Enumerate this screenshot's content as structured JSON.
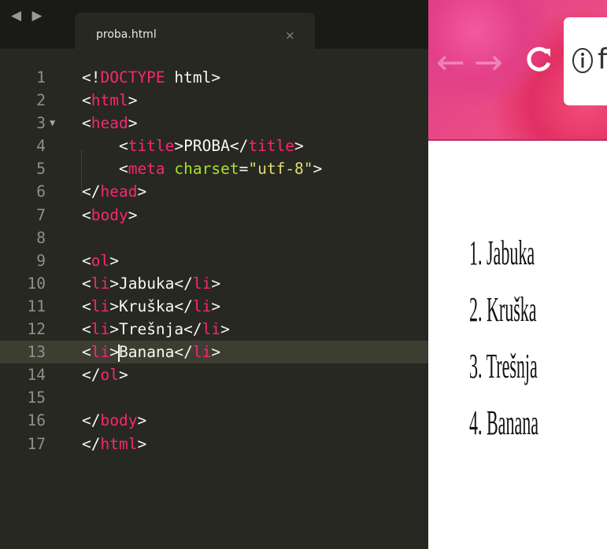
{
  "editor": {
    "tab_nav_arrows": "◀ ▶",
    "tab_title": "proba.html",
    "tab_close": "×",
    "current_line": 13,
    "lines": [
      {
        "n": "1",
        "tokens": [
          [
            "d",
            "<!"
          ],
          [
            "pk",
            "DOCTYPE"
          ],
          [
            "d",
            " html>"
          ]
        ]
      },
      {
        "n": "2",
        "tokens": [
          [
            "d",
            "<"
          ],
          [
            "pk",
            "html"
          ],
          [
            "d",
            ">"
          ]
        ]
      },
      {
        "n": "3",
        "fold": "▼",
        "tokens": [
          [
            "d",
            "<"
          ],
          [
            "pk",
            "head"
          ],
          [
            "d",
            ">"
          ]
        ]
      },
      {
        "n": "4",
        "tokens": [
          [
            "d",
            "    <"
          ],
          [
            "pk",
            "title"
          ],
          [
            "d",
            ">PROBA</"
          ],
          [
            "pk",
            "title"
          ],
          [
            "d",
            ">"
          ]
        ]
      },
      {
        "n": "5",
        "tokens": [
          [
            "d",
            "    <"
          ],
          [
            "pk",
            "meta"
          ],
          [
            "d",
            " "
          ],
          [
            "gr",
            "charset"
          ],
          [
            "d",
            "="
          ],
          [
            "yl",
            "\"utf-8\""
          ],
          [
            "d",
            ">"
          ]
        ]
      },
      {
        "n": "6",
        "tokens": [
          [
            "d",
            "</"
          ],
          [
            "pk",
            "head"
          ],
          [
            "d",
            ">"
          ]
        ]
      },
      {
        "n": "7",
        "tokens": [
          [
            "d",
            "<"
          ],
          [
            "pk",
            "body"
          ],
          [
            "d",
            ">"
          ]
        ]
      },
      {
        "n": "8",
        "tokens": []
      },
      {
        "n": "9",
        "tokens": [
          [
            "d",
            "<"
          ],
          [
            "pk",
            "ol"
          ],
          [
            "d",
            ">"
          ]
        ]
      },
      {
        "n": "10",
        "tokens": [
          [
            "d",
            "<"
          ],
          [
            "pk",
            "li"
          ],
          [
            "d",
            ">Jabuka</"
          ],
          [
            "pk",
            "li"
          ],
          [
            "d",
            ">"
          ]
        ]
      },
      {
        "n": "11",
        "tokens": [
          [
            "d",
            "<"
          ],
          [
            "pk",
            "li"
          ],
          [
            "d",
            ">Kruška</"
          ],
          [
            "pk",
            "li"
          ],
          [
            "d",
            ">"
          ]
        ]
      },
      {
        "n": "12",
        "tokens": [
          [
            "d",
            "<"
          ],
          [
            "pk",
            "li"
          ],
          [
            "d",
            ">Trešnja</"
          ],
          [
            "pk",
            "li"
          ],
          [
            "d",
            ">"
          ]
        ]
      },
      {
        "n": "13",
        "tokens": [
          [
            "d",
            "<"
          ],
          [
            "pk",
            "li"
          ],
          [
            "d",
            ">"
          ],
          [
            "cursor",
            ""
          ],
          [
            "d",
            "Banana</"
          ],
          [
            "pk",
            "li"
          ],
          [
            "d",
            ">"
          ]
        ]
      },
      {
        "n": "14",
        "tokens": [
          [
            "d",
            "</"
          ],
          [
            "pk",
            "ol"
          ],
          [
            "d",
            ">"
          ]
        ]
      },
      {
        "n": "15",
        "tokens": []
      },
      {
        "n": "16",
        "tokens": [
          [
            "d",
            "</"
          ],
          [
            "pk",
            "body"
          ],
          [
            "d",
            ">"
          ]
        ]
      },
      {
        "n": "17",
        "tokens": [
          [
            "d",
            "</"
          ],
          [
            "pk",
            "html"
          ],
          [
            "d",
            ">"
          ]
        ]
      }
    ]
  },
  "browser": {
    "back_icon": "arrow-left-icon",
    "forward_icon": "arrow-right-icon",
    "reload_icon": "reload-icon",
    "info_icon": "info-icon",
    "address_text": "f",
    "list_items": [
      "1. Jabuka",
      "2. Kruška",
      "3. Trešnja",
      "4. Banana"
    ]
  },
  "colors": {
    "editor_bg": "#272822",
    "tag": "#f92672",
    "attribute": "#a6e22e",
    "string": "#e6db74",
    "text": "#f8f8f2",
    "line_number": "#8f908a",
    "toolbar_pink": "#e23f87"
  }
}
